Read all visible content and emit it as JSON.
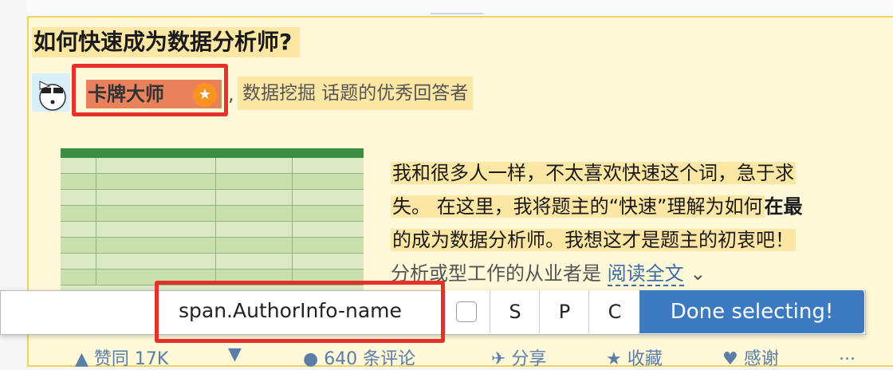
{
  "question": {
    "title": "如何快速成为数据分析师?"
  },
  "author": {
    "name": "卡牌大师",
    "badge_icon": "star-badge-icon",
    "separator": ",",
    "headline": "数据挖掘 话题的优秀回答者"
  },
  "excerpt": {
    "line1": "我和很多人一样，不太喜欢快速这个词，急于求",
    "line2a": "失。 在这里，我将题主的“快速”理解为如何",
    "line2b": "在最",
    "line3": "的成为数据分析师。我想这才是题主的初衷吧！",
    "line4": "分析或型工作的从业者是",
    "read_all": "阅读全文",
    "read_all_icon": "chevron-down-icon"
  },
  "actions": {
    "upvote": "▲ 赞同 17K",
    "downvote": "▼",
    "comments": "● 640 条评论",
    "share": "✈ 分享",
    "favorite": "★ 收藏",
    "thanks": "♥ 感谢",
    "more": "..."
  },
  "selector_bar": {
    "selector_value": "span.AuthorInfo-name",
    "segment_s": "S",
    "segment_p": "P",
    "segment_c": "C",
    "done_label": "Done selecting!"
  },
  "colors": {
    "highlight_border": "#e5312a",
    "done_button": "#3c7bc1",
    "card_highlight": "#fff8d9"
  }
}
